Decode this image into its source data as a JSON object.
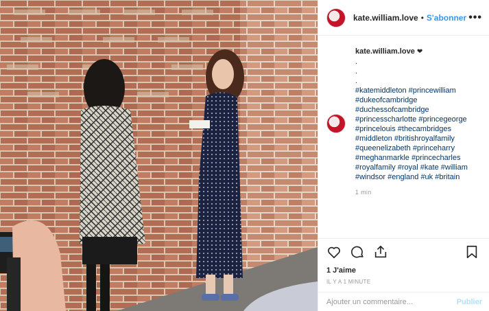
{
  "post": {
    "username": "kate.william.love",
    "follow_label": "S'abonner",
    "separator": "•",
    "more_label": "•••"
  },
  "caption": {
    "username": "kate.william.love",
    "heart": "❤",
    "dots": [
      ".",
      ".",
      "."
    ],
    "hashtags": [
      "#katemiddleton",
      "#princewilliam",
      "#dukeofcambridge",
      "#duchessofcambridge",
      "#princesscharlotte",
      "#princegeorge",
      "#princelouis",
      "#thecambridges",
      "#middleton",
      "#britishroyalfamily",
      "#queenelizabeth",
      "#princeharry",
      "#meghanmarkle",
      "#princecharles",
      "#royalfamily",
      "#royal",
      "#kate",
      "#william",
      "#windsor",
      "#england",
      "#uk",
      "#britain"
    ],
    "time": "1 min"
  },
  "actions": {
    "icons": [
      "heart-icon",
      "comment-icon",
      "share-icon",
      "bookmark-icon"
    ],
    "likes": "1 J'aime",
    "posted": "IL Y A 1 MINUTE"
  },
  "comment_box": {
    "placeholder": "Ajouter un commentaire...",
    "publish_label": "Publier"
  },
  "colors": {
    "link": "#3897f0",
    "hashtag": "#003569",
    "muted": "#999999",
    "publish_disabled": "#b2dffc",
    "brick": "#b5735a",
    "dress": "#1c2340"
  }
}
